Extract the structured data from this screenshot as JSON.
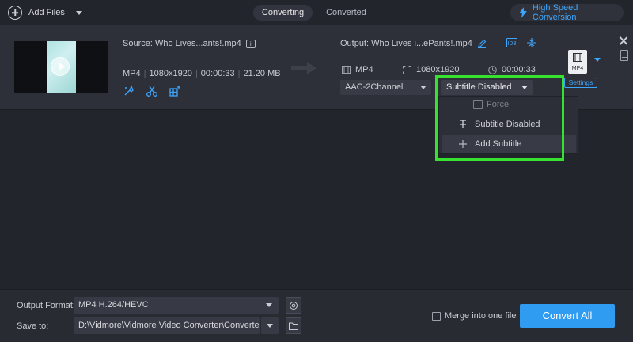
{
  "colors": {
    "accent": "#2f9cf2",
    "highlight": "#36e22f",
    "background": "#23252d"
  },
  "topbar": {
    "add_files": "Add Files",
    "tabs": [
      {
        "label": "Converting"
      },
      {
        "label": "Converted"
      }
    ],
    "high_speed": "High Speed Conversion"
  },
  "file": {
    "source": "Source: Who Lives...ants!.mp4",
    "format": "MP4",
    "resolution": "1080x1920",
    "duration": "00:00:33",
    "size": "21.20 MB",
    "output": {
      "name": "Output: Who Lives i...ePants!.mp4",
      "format": "MP4",
      "resolution": "1080x1920",
      "duration": "00:00:33",
      "audio": "AAC-2Channel",
      "subtitle": "Subtitle Disabled",
      "format_badge": "MP4",
      "settings": "Settings"
    }
  },
  "subtitle_menu": {
    "force": "Force",
    "items": [
      {
        "label": "Subtitle Disabled",
        "icon": "text-strike-icon"
      },
      {
        "label": "Add Subtitle",
        "icon": "plus-icon"
      }
    ]
  },
  "bottom": {
    "output_format_label": "Output Format:",
    "output_format_value": "MP4 H.264/HEVC",
    "save_to_label": "Save to:",
    "save_to_value": "D:\\Vidmore\\Vidmore Video Converter\\Converted",
    "merge_label": "Merge into one file",
    "convert_all": "Convert All"
  }
}
